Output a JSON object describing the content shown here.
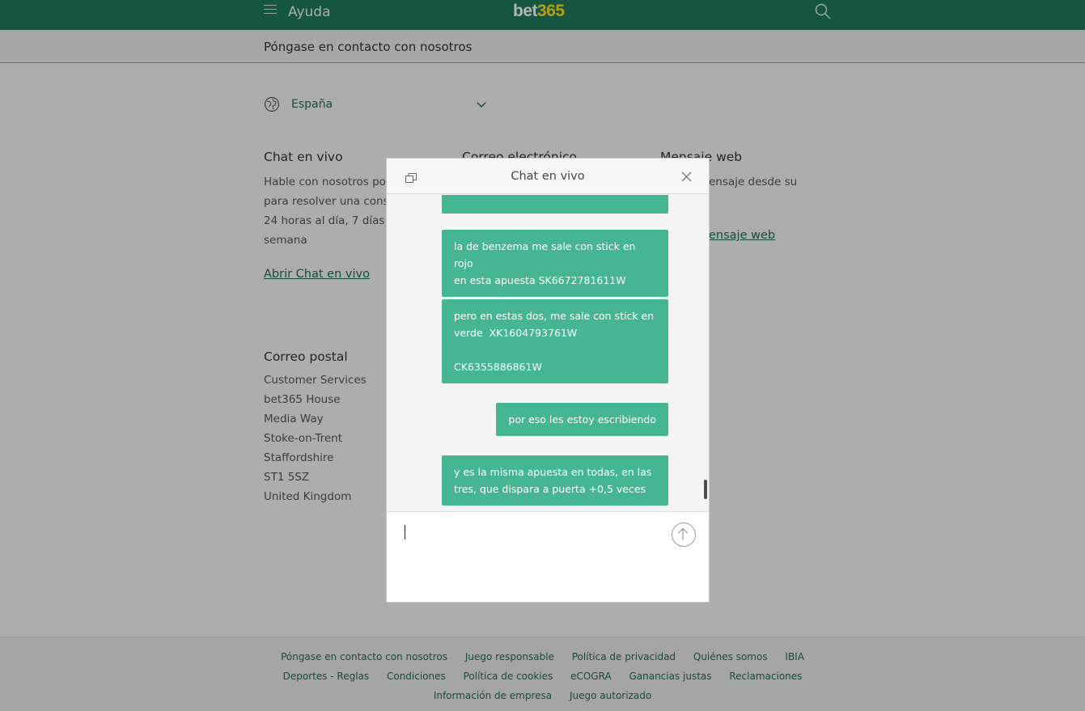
{
  "header": {
    "menu_icon": "hamburger-icon",
    "title": "Ayuda",
    "logo_main": "bet",
    "logo_number": "365",
    "search_icon": "search-icon",
    "brand_color": "#1f7a5c",
    "logo_accent": "#ffdf1b"
  },
  "subheader": {
    "title": "Póngase en contacto con nosotros"
  },
  "country": {
    "label": "España",
    "icon": "globe-icon",
    "dropdown_icon": "chevron-down-icon"
  },
  "contact": {
    "chat": {
      "title": "Chat en vivo",
      "lines": [
        "Hable con nosotros por",
        "para resolver una cons",
        "24 horas al día, 7 días",
        "semana"
      ],
      "link": "Abrir Chat en vivo"
    },
    "email": {
      "title": "Correo electrónico"
    },
    "web": {
      "title": "Mensaje web",
      "line": "ensaje desde su",
      "link": "ensaje web"
    }
  },
  "postal": {
    "title": "Correo postal",
    "lines": [
      "Customer Services",
      "bet365 House",
      "Media Way",
      "Stoke-on-Trent",
      "Staffordshire",
      "ST1 5SZ",
      "United Kingdom"
    ]
  },
  "footer": {
    "row1": [
      "Póngase en contacto con nosotros",
      "Juego responsable",
      "Política de privacidad",
      "Quiénes somos",
      "IBIA"
    ],
    "row2": [
      "Deportes - Reglas",
      "Condiciones",
      "Política de cookies",
      "eCOGRA",
      "Ganancias justas",
      "Reclamaciones"
    ],
    "row3": [
      "Información de empresa",
      "Juego autorizado"
    ]
  },
  "chat_window": {
    "title": "Chat en vivo",
    "popout_icon": "popout-icon",
    "close_icon": "close-icon",
    "bubble_color": "#46b592",
    "messages": [
      "",
      "la de benzema me sale con stick en rojo\nen esta apuesta SK6672781611W",
      "pero en estas dos, me sale con stick en\nverde  XK1604793761W\n\nCK6355886861W",
      "por eso les estoy escribiendo",
      "y es la misma apuesta en todas, en las\ntres, que dispara a puerta +0,5 veces"
    ],
    "input_value": "",
    "send_icon": "arrow-up-icon"
  }
}
